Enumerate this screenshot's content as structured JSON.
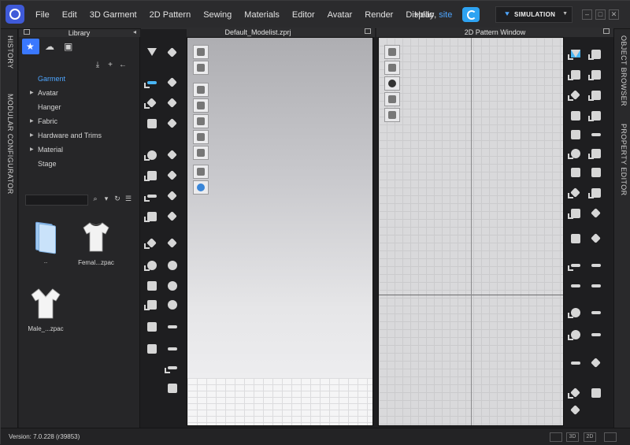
{
  "menu": {
    "items": [
      "File",
      "Edit",
      "3D Garment",
      "2D Pattern",
      "Sewing",
      "Materials",
      "Editor",
      "Avatar",
      "Render",
      "Display"
    ],
    "greeting": "Hello,",
    "username": "site",
    "simulation_label": "SIMULATION"
  },
  "side_tabs": {
    "left": [
      "HISTORY",
      "MODULAR CONFIGURATOR"
    ],
    "right": [
      "OBJECT BROWSER",
      "PROPERTY EDITOR"
    ]
  },
  "library": {
    "title": "Library",
    "tree": [
      {
        "label": "Garment",
        "expandable": false,
        "selected": true
      },
      {
        "label": "Avatar",
        "expandable": true,
        "selected": false
      },
      {
        "label": "Hanger",
        "expandable": false,
        "selected": false
      },
      {
        "label": "Fabric",
        "expandable": true,
        "selected": false
      },
      {
        "label": "Hardware and Trims",
        "expandable": true,
        "selected": false
      },
      {
        "label": "Material",
        "expandable": true,
        "selected": false
      },
      {
        "label": "Stage",
        "expandable": false,
        "selected": false
      }
    ],
    "files": [
      {
        "label": "..",
        "kind": "folder"
      },
      {
        "label": "Femal...zpac",
        "kind": "tshirt"
      },
      {
        "label": "Male_...zpac",
        "kind": "vneck"
      }
    ]
  },
  "window_3d": {
    "title": "Default_Modelist.zprj"
  },
  "window_2d": {
    "title": "2D Pattern Window"
  },
  "status": {
    "version": "Version: 7.0.228 (r39853)",
    "view_buttons": [
      "",
      "3D",
      "2D"
    ]
  },
  "colors": {
    "accent": "#3a78ff",
    "link": "#4ea6ff",
    "cloud": "#2ea3f2",
    "select_icon": "#49b6f5"
  }
}
